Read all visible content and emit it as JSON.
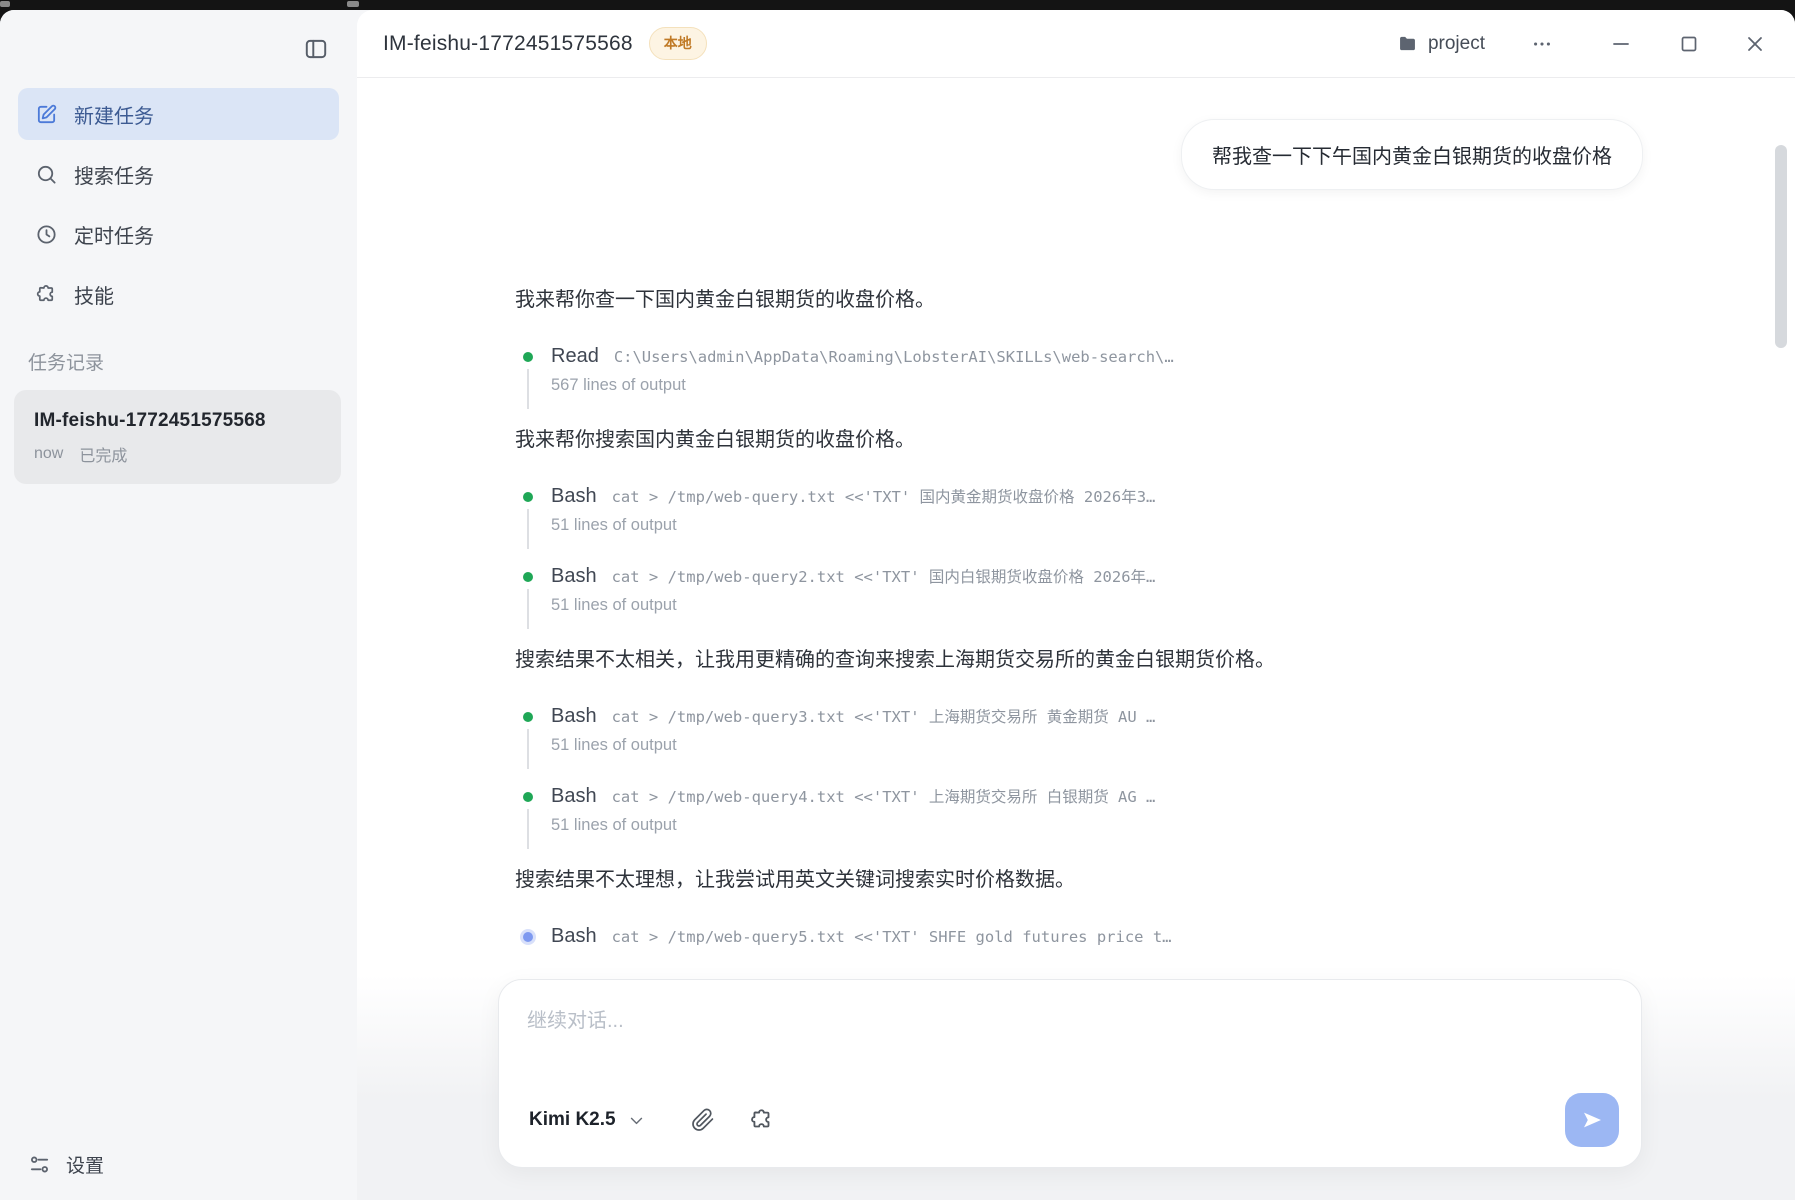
{
  "titlebar": {
    "title": "IM-feishu-1772451575568",
    "badge": "本地",
    "project_label": "project"
  },
  "sidebar": {
    "items": [
      {
        "label": "新建任务",
        "icon": "edit-icon",
        "active": true
      },
      {
        "label": "搜索任务",
        "icon": "search-icon",
        "active": false
      },
      {
        "label": "定时任务",
        "icon": "clock-icon",
        "active": false
      },
      {
        "label": "技能",
        "icon": "puzzle-icon",
        "active": false
      }
    ],
    "section_label": "任务记录",
    "task": {
      "title": "IM-feishu-1772451575568",
      "time": "now",
      "status": "已完成"
    },
    "settings_label": "设置"
  },
  "chat": {
    "user_message": "帮我查一下下午国内黄金白银期货的收盘价格",
    "blocks": [
      {
        "type": "text",
        "text": "我来帮你查一下国内黄金白银期货的收盘价格。"
      },
      {
        "type": "tool",
        "label": "Read",
        "command": "C:\\Users\\admin\\AppData\\Roaming\\LobsterAI\\SKILLs\\web-search\\…",
        "output": "567 lines of output",
        "status": "done"
      },
      {
        "type": "text",
        "text": "我来帮你搜索国内黄金白银期货的收盘价格。"
      },
      {
        "type": "tool",
        "label": "Bash",
        "command": "cat > /tmp/web-query.txt <<'TXT' 国内黄金期货收盘价格 2026年3…",
        "output": "51 lines of output",
        "status": "done"
      },
      {
        "type": "tool",
        "label": "Bash",
        "command": "cat > /tmp/web-query2.txt <<'TXT' 国内白银期货收盘价格 2026年…",
        "output": "51 lines of output",
        "status": "done"
      },
      {
        "type": "text",
        "text": "搜索结果不太相关，让我用更精确的查询来搜索上海期货交易所的黄金白银期货价格。"
      },
      {
        "type": "tool",
        "label": "Bash",
        "command": "cat > /tmp/web-query3.txt <<'TXT' 上海期货交易所 黄金期货 AU …",
        "output": "51 lines of output",
        "status": "done"
      },
      {
        "type": "tool",
        "label": "Bash",
        "command": "cat > /tmp/web-query4.txt <<'TXT' 上海期货交易所 白银期货 AG …",
        "output": "51 lines of output",
        "status": "done"
      },
      {
        "type": "text",
        "text": "搜索结果不太理想，让我尝试用英文关键词搜索实时价格数据。"
      },
      {
        "type": "tool",
        "label": "Bash",
        "command": "cat > /tmp/web-query5.txt <<'TXT' SHFE gold futures price t…",
        "output": null,
        "status": "running"
      }
    ]
  },
  "composer": {
    "placeholder": "继续对话...",
    "model": "Kimi K2.5"
  },
  "colors": {
    "accent_blue": "#9cb7f3",
    "active_item_bg": "#dbe5f6",
    "badge_text": "#c07a26",
    "badge_bg": "#fdf4e3",
    "bullet_done": "#1fa756",
    "bullet_running": "#7e99f0"
  }
}
